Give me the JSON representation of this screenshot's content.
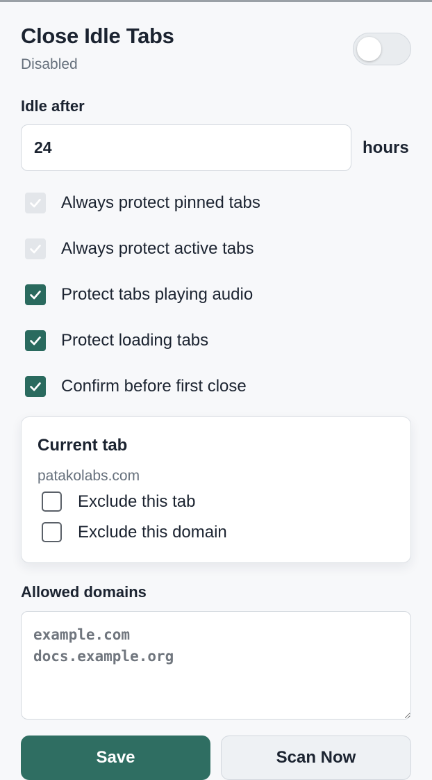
{
  "header": {
    "title": "Close Idle Tabs",
    "status": "Disabled",
    "toggle_on": false
  },
  "idle": {
    "label": "Idle after",
    "value": "24",
    "unit": "hours"
  },
  "options": [
    {
      "label": "Always protect pinned tabs",
      "checked": true,
      "disabled": true
    },
    {
      "label": "Always protect active tabs",
      "checked": true,
      "disabled": true
    },
    {
      "label": "Protect tabs playing audio",
      "checked": true,
      "disabled": false
    },
    {
      "label": "Protect loading tabs",
      "checked": true,
      "disabled": false
    },
    {
      "label": "Confirm before first close",
      "checked": true,
      "disabled": false
    }
  ],
  "current_tab": {
    "title": "Current tab",
    "domain": "patakolabs.com",
    "exclude_tab_label": "Exclude this tab",
    "exclude_tab_checked": false,
    "exclude_domain_label": "Exclude this domain",
    "exclude_domain_checked": false
  },
  "allowed_domains": {
    "label": "Allowed domains",
    "placeholder": "example.com\ndocs.example.org",
    "value": ""
  },
  "buttons": {
    "save": "Save",
    "scan": "Scan Now"
  },
  "colors": {
    "accent": "#2f6e62",
    "checkbox_on": "#2a6a5e",
    "checkbox_disabled": "#e3e6ea",
    "muted_text": "#66707c",
    "background": "#f7f8fa"
  }
}
